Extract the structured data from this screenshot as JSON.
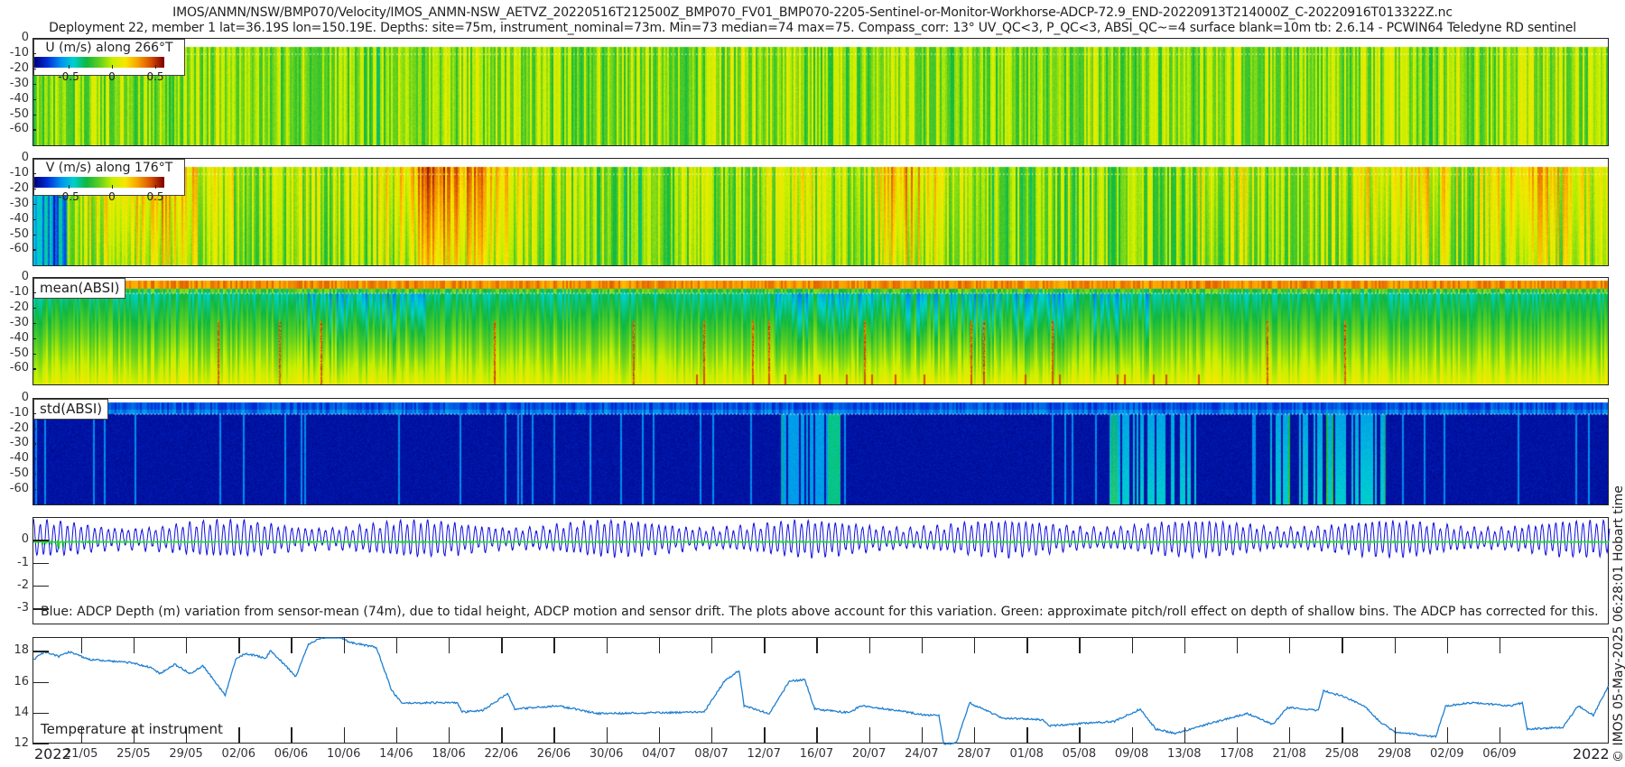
{
  "header": {
    "title_line1": "IMOS/ANMN/NSW/BMP070/Velocity/IMOS_ANMN-NSW_AETVZ_20220516T212500Z_BMP070_FV01_BMP070-2205-Sentinel-or-Monitor-Workhorse-ADCP-72.9_END-20220913T214000Z_C-20220916T013322Z.nc",
    "title_line2": "Deployment 22, member 1 lat=36.19S lon=150.19E. Depths: site=75m, instrument_nominal=73m. Min=73 median=74 max=75. Compass_corr: 13° UV_QC<3, P_QC<3, ABSI_QC~=4 surface blank=10m tb: 2.6.14 - PCWIN64 Teledyne RD sentinel"
  },
  "footer": {
    "year_left": "2022",
    "year_right": "2022",
    "credit": "© IMOS 05-May-2025 06:28:01 Hobart time"
  },
  "colors": {
    "colormap": [
      "#00007f",
      "#0030d8",
      "#0090f0",
      "#00d0d0",
      "#10b840",
      "#60d020",
      "#c8f000",
      "#f8e800",
      "#f8a000",
      "#d85000",
      "#800000"
    ],
    "depth_line": "#1010e0",
    "pitch_roll_line": "#20e020",
    "temperature_line": "#1f7fd0"
  },
  "time_axis": {
    "start": "2022-05-17T07:25",
    "end": "2022-09-14T07:40",
    "ticks": [
      "2022-05-21",
      "2022-05-25",
      "2022-05-29",
      "2022-06-02",
      "2022-06-06",
      "2022-06-10",
      "2022-06-14",
      "2022-06-18",
      "2022-06-22",
      "2022-06-26",
      "2022-06-30",
      "2022-07-04",
      "2022-07-08",
      "2022-07-12",
      "2022-07-16",
      "2022-07-20",
      "2022-07-24",
      "2022-07-28",
      "2022-08-01",
      "2022-08-05",
      "2022-08-09",
      "2022-08-13",
      "2022-08-17",
      "2022-08-21",
      "2022-08-25",
      "2022-08-29",
      "2022-09-02",
      "2022-09-06"
    ],
    "tick_labels": [
      "21/05",
      "25/05",
      "29/05",
      "02/06",
      "06/06",
      "10/06",
      "14/06",
      "18/06",
      "22/06",
      "26/06",
      "30/06",
      "04/07",
      "08/07",
      "12/07",
      "16/07",
      "20/07",
      "24/07",
      "28/07",
      "01/08",
      "05/08",
      "09/08",
      "13/08",
      "17/08",
      "21/08",
      "25/08",
      "29/08",
      "02/09",
      "06/09"
    ]
  },
  "chart_data": [
    {
      "type": "heatmap",
      "title": "U (m/s) along 266°T",
      "ylim": [
        -71,
        0
      ],
      "yticks": [
        0,
        -10,
        -20,
        -30,
        -40,
        -50,
        -60
      ],
      "ytick_labels": [
        "0",
        "-10",
        "-20",
        "-30",
        "-40",
        "-50",
        "-60"
      ],
      "clim": [
        -0.75,
        0.75
      ],
      "colorbar_ticks": [
        -0.5,
        0,
        0.5
      ],
      "colorbar_labels": [
        "-0.5",
        "0",
        "0.5"
      ],
      "surface_blank_line_depth": -10,
      "column_means_4day": [
        0.05,
        0.08,
        0.05,
        0.1,
        0.05,
        0.08,
        0.0,
        0.1,
        0.08,
        0.05,
        0.05,
        0.08,
        0.05,
        0.1,
        0.08,
        0.05,
        0.1,
        0.05,
        0.03,
        0.05,
        0.08,
        0.05,
        0.1,
        0.08,
        0.05,
        0.1,
        0.05,
        0.08,
        0.1,
        0.05
      ]
    },
    {
      "type": "heatmap",
      "title": "V (m/s) along 176°T",
      "ylim": [
        -71,
        0
      ],
      "yticks": [
        0,
        -10,
        -20,
        -30,
        -40,
        -50,
        -60
      ],
      "ytick_labels": [
        "0",
        "-10",
        "-20",
        "-30",
        "-40",
        "-50",
        "-60"
      ],
      "clim": [
        -0.75,
        0.75
      ],
      "colorbar_ticks": [
        -0.5,
        0,
        0.5
      ],
      "colorbar_labels": [
        "-0.5",
        "0",
        "0.5"
      ],
      "surface_blank_line_depth": -10,
      "column_means_4day": [
        0.0,
        0.3,
        0.35,
        0.15,
        0.1,
        0.1,
        0.1,
        0.45,
        0.35,
        0.15,
        0.05,
        0.0,
        0.1,
        0.05,
        0.15,
        0.05,
        0.35,
        0.15,
        0.0,
        0.05,
        0.0,
        0.05,
        0.15,
        0.1,
        0.05,
        0.2,
        0.25,
        0.1,
        0.35,
        0.15
      ]
    },
    {
      "type": "heatmap",
      "title": "mean(ABSI)",
      "ylim": [
        -71,
        0
      ],
      "yticks": [
        0,
        -10,
        -20,
        -30,
        -40,
        -50,
        -60
      ],
      "ytick_labels": [
        "0",
        "-10",
        "-20",
        "-30",
        "-40",
        "-50",
        "-60"
      ],
      "surface_blank_line_depth": -10
    },
    {
      "type": "heatmap",
      "title": "std(ABSI)",
      "ylim": [
        -71,
        0
      ],
      "yticks": [
        0,
        -10,
        -20,
        -30,
        -40,
        -50,
        -60
      ],
      "ytick_labels": [
        "0",
        "-10",
        "-20",
        "-30",
        "-40",
        "-50",
        "-60"
      ],
      "surface_blank_line_depth": -10
    },
    {
      "type": "line",
      "ylim": [
        -3.7,
        1
      ],
      "yticks": [
        0,
        -1,
        -2,
        -3
      ],
      "ytick_labels": [
        "0",
        "-1",
        "-2",
        "-3"
      ],
      "annotation": "Blue: ADCP Depth (m) variation from sensor-mean (74m), due to tidal height, ADCP motion and sensor drift. The plots above account for this variation. Green: approximate pitch/roll effect on depth of shallow bins. The ADCP has corrected for this."
    },
    {
      "type": "line",
      "annotation": "Temperature at instrument",
      "ylim": [
        12,
        18.9
      ],
      "yticks": [
        12,
        14,
        16,
        18
      ],
      "ytick_labels": [
        "12",
        "14",
        "16",
        "18"
      ],
      "points": [
        [
          "2022-05-17T08",
          17.5
        ],
        [
          "2022-05-18T03",
          18.0
        ],
        [
          "2022-05-19T06",
          17.7
        ],
        [
          "2022-05-20T01",
          18.0
        ],
        [
          "2022-05-21T14",
          17.5
        ],
        [
          "2022-05-24T16",
          17.3
        ],
        [
          "2022-05-26T04",
          17.0
        ],
        [
          "2022-05-26T23",
          16.6
        ],
        [
          "2022-05-28T02",
          17.2
        ],
        [
          "2022-05-29T06",
          16.6
        ],
        [
          "2022-05-30T05",
          17.1
        ],
        [
          "2022-05-31T22",
          15.2
        ],
        [
          "2022-06-01T17",
          17.5
        ],
        [
          "2022-06-02T11",
          17.9
        ],
        [
          "2022-06-04T00",
          17.6
        ],
        [
          "2022-06-04T09",
          18.1
        ],
        [
          "2022-06-06T07",
          16.4
        ],
        [
          "2022-06-07T06",
          18.5
        ],
        [
          "2022-06-08T05",
          18.9
        ],
        [
          "2022-06-09T09",
          19.0
        ],
        [
          "2022-06-10T12",
          18.6
        ],
        [
          "2022-06-12T10",
          18.3
        ],
        [
          "2022-06-12T20",
          17.3
        ],
        [
          "2022-06-13T14",
          15.5
        ],
        [
          "2022-06-14T08",
          14.7
        ],
        [
          "2022-06-18T14",
          14.7
        ],
        [
          "2022-06-18T23",
          14.1
        ],
        [
          "2022-06-20T12",
          14.2
        ],
        [
          "2022-06-22T10",
          15.3
        ],
        [
          "2022-06-22T23",
          14.3
        ],
        [
          "2022-06-26T06",
          14.5
        ],
        [
          "2022-06-29T07",
          14.0
        ],
        [
          "2022-07-07T09",
          14.1
        ],
        [
          "2022-07-08T22",
          16.1
        ],
        [
          "2022-07-10T01",
          16.8
        ],
        [
          "2022-07-10T10",
          14.5
        ],
        [
          "2022-07-12T08",
          14.0
        ],
        [
          "2022-07-13T21",
          16.1
        ],
        [
          "2022-07-15T01",
          16.2
        ],
        [
          "2022-07-15T19",
          14.3
        ],
        [
          "2022-07-18T11",
          14.05
        ],
        [
          "2022-07-19T06",
          14.5
        ],
        [
          "2022-07-20T10",
          14.4
        ],
        [
          "2022-07-24T07",
          13.9
        ],
        [
          "2022-07-25T06",
          13.9
        ],
        [
          "2022-07-25T15",
          12.0
        ],
        [
          "2022-07-26T14",
          12.1
        ],
        [
          "2022-07-27T14",
          14.7
        ],
        [
          "2022-07-30T02",
          13.7
        ],
        [
          "2022-08-02T05",
          13.6
        ],
        [
          "2022-08-02T14",
          13.2
        ],
        [
          "2022-08-07T15",
          13.5
        ],
        [
          "2022-08-09T14",
          14.3
        ],
        [
          "2022-08-10T18",
          13.0
        ],
        [
          "2022-08-12T07",
          12.7
        ],
        [
          "2022-08-14T15",
          13.3
        ],
        [
          "2022-08-17T17",
          14.0
        ],
        [
          "2022-08-19T16",
          13.3
        ],
        [
          "2022-08-20T19",
          14.4
        ],
        [
          "2022-08-23T03",
          14.2
        ],
        [
          "2022-08-23T13",
          15.5
        ],
        [
          "2022-08-25T02",
          15.1
        ],
        [
          "2022-08-26T15",
          14.5
        ],
        [
          "2022-08-27T19",
          13.5
        ],
        [
          "2022-08-28T23",
          12.8
        ],
        [
          "2022-09-01T02",
          12.5
        ],
        [
          "2022-09-01T20",
          14.5
        ],
        [
          "2022-09-03T18",
          14.7
        ],
        [
          "2022-09-06T21",
          14.5
        ],
        [
          "2022-09-07T16",
          14.7
        ],
        [
          "2022-09-08T01",
          13.0
        ],
        [
          "2022-09-10T18",
          13.1
        ],
        [
          "2022-09-11T22",
          14.5
        ],
        [
          "2022-09-13T02",
          13.9
        ],
        [
          "2022-09-14T07",
          15.9
        ]
      ]
    }
  ]
}
